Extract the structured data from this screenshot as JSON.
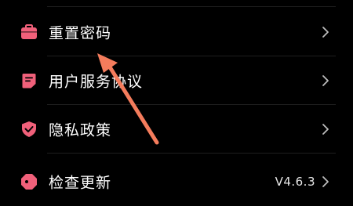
{
  "colors": {
    "background": "#000000",
    "icon_accent": "#f0607a",
    "label": "#ffffff",
    "chevron": "#bdbdbd",
    "divider": "#1f1f1f",
    "annotation_arrow": "#f47c5c"
  },
  "settings": {
    "items": [
      {
        "label": "重置密码",
        "icon": "briefcase-icon",
        "value": ""
      },
      {
        "label": "用户服务协议",
        "icon": "document-icon",
        "value": ""
      },
      {
        "label": "隐私政策",
        "icon": "shield-check-icon",
        "value": ""
      },
      {
        "label": "检查更新",
        "icon": "update-tag-icon",
        "value": "V4.6.3"
      }
    ]
  }
}
